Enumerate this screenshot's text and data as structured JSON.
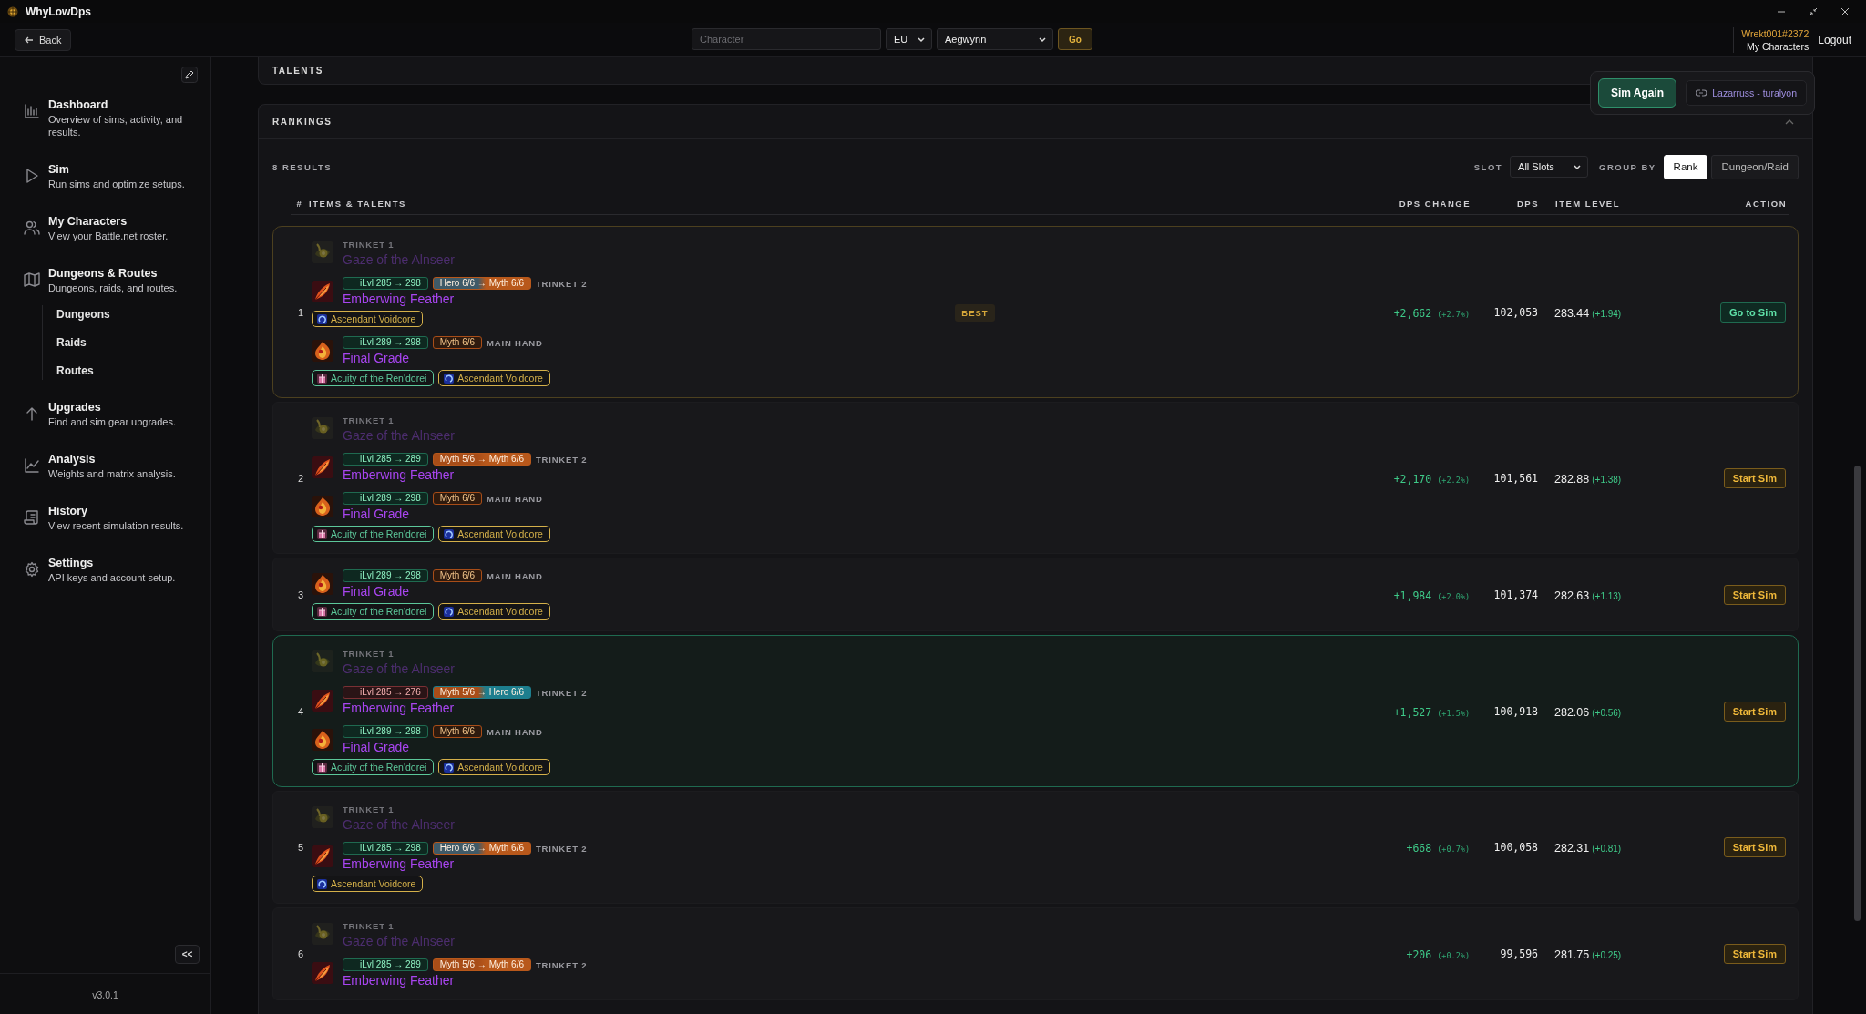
{
  "window": {
    "title": "WhyLowDps"
  },
  "topbar": {
    "back": "Back",
    "character": {
      "placeholder": "Character"
    },
    "region": "EU",
    "realm": "Aegwynn",
    "go": "Go",
    "battletag": "Wrekt001#2372",
    "my_characters": "My Characters",
    "logout": "Logout"
  },
  "sidebar": {
    "items": [
      {
        "title": "Dashboard",
        "desc": "Overview of sims, activity, and results."
      },
      {
        "title": "Sim",
        "desc": "Run sims and optimize setups."
      },
      {
        "title": "My Characters",
        "desc": "View your Battle.net roster."
      },
      {
        "title": "Dungeons & Routes",
        "desc": "Dungeons, raids, and routes.",
        "children": [
          {
            "label": "Dungeons"
          },
          {
            "label": "Raids"
          },
          {
            "label": "Routes"
          }
        ]
      },
      {
        "title": "Upgrades",
        "desc": "Find and sim gear upgrades."
      },
      {
        "title": "Analysis",
        "desc": "Weights and matrix analysis."
      },
      {
        "title": "History",
        "desc": "View recent simulation results."
      },
      {
        "title": "Settings",
        "desc": "API keys and account setup."
      }
    ],
    "collapse": "<<",
    "version": "v3.0.1"
  },
  "popup": {
    "primary": "Sim Again",
    "link": "Lazarruss - turalyon"
  },
  "talents": {
    "title": "TALENTS"
  },
  "rankings": {
    "title": "RANKINGS",
    "results": "8 RESULTS",
    "slot_label": "SLOT",
    "slot_value": "All Slots",
    "group_label": "GROUP BY",
    "group_options": [
      {
        "label": "Rank",
        "selected": true
      },
      {
        "label": "Dungeon/Raid",
        "selected": false
      }
    ],
    "columns": [
      "#",
      "ITEMS & TALENTS",
      "DPS CHANGE",
      "DPS",
      "ITEM LEVEL",
      "ACTION"
    ],
    "rows": [
      {
        "rank": "1",
        "best": true,
        "selected": false,
        "badge": "BEST",
        "items": [
          {
            "kind": "orb",
            "dimmed": true,
            "slot": "TRINKET 1",
            "name": "Gaze of the Alnseer"
          },
          {
            "kind": "feather",
            "dimmed": false,
            "ilvl": {
              "text": "iLvl 285 → 298",
              "downgrade": false
            },
            "track": {
              "text": "Hero 6/6 → Myth 6/6",
              "upgrade": true,
              "from_hero": true,
              "to_hero": false
            },
            "slot": "TRINKET 2",
            "name": "Emberwing Feather",
            "chips": [
              {
                "kind": "swirl",
                "text": "Ascendant Voidcore",
                "color": "#d4b04a"
              }
            ]
          },
          {
            "kind": "flame",
            "dimmed": false,
            "ilvl": {
              "text": "iLvl 289 → 298",
              "downgrade": false
            },
            "track": {
              "text": "Myth 6/6",
              "upgrade": false,
              "from_hero": false
            },
            "slot": "MAIN HAND",
            "name": "Final Grade",
            "chips": [
              {
                "kind": "ribbon",
                "text": "Acuity of the Ren'dorei",
                "color": "#5cc79a"
              },
              {
                "kind": "swirl",
                "text": "Ascendant Voidcore",
                "color": "#d4b04a"
              }
            ]
          }
        ],
        "dps_change": "+2,662",
        "dps_pct": "(+2.7%)",
        "dps": "102,053",
        "item_level": "283.44",
        "ilvl_delta": "(+1.94)",
        "action": "Go to Sim",
        "action_primary": true
      },
      {
        "rank": "2",
        "best": false,
        "selected": false,
        "items": [
          {
            "kind": "orb",
            "dimmed": true,
            "slot": "TRINKET 1",
            "name": "Gaze of the Alnseer"
          },
          {
            "kind": "feather",
            "dimmed": false,
            "ilvl": {
              "text": "iLvl 285 → 289",
              "downgrade": false
            },
            "track": {
              "text": "Myth 5/6 → Myth 6/6",
              "upgrade": true,
              "from_hero": false,
              "to_hero": false
            },
            "slot": "TRINKET 2",
            "name": "Emberwing Feather"
          },
          {
            "kind": "flame",
            "dimmed": false,
            "ilvl": {
              "text": "iLvl 289 → 298",
              "downgrade": false
            },
            "track": {
              "text": "Myth 6/6",
              "upgrade": false,
              "from_hero": false
            },
            "slot": "MAIN HAND",
            "name": "Final Grade",
            "chips": [
              {
                "kind": "ribbon",
                "text": "Acuity of the Ren'dorei",
                "color": "#5cc79a"
              },
              {
                "kind": "swirl",
                "text": "Ascendant Voidcore",
                "color": "#d4b04a"
              }
            ]
          }
        ],
        "dps_change": "+2,170",
        "dps_pct": "(+2.2%)",
        "dps": "101,561",
        "item_level": "282.88",
        "ilvl_delta": "(+1.38)",
        "action": "Start Sim",
        "action_primary": false
      },
      {
        "rank": "3",
        "best": false,
        "selected": false,
        "items": [
          {
            "kind": "flame",
            "dimmed": false,
            "ilvl": {
              "text": "iLvl 289 → 298",
              "downgrade": false
            },
            "track": {
              "text": "Myth 6/6",
              "upgrade": false,
              "from_hero": false
            },
            "slot": "MAIN HAND",
            "name": "Final Grade",
            "chips": [
              {
                "kind": "ribbon",
                "text": "Acuity of the Ren'dorei",
                "color": "#5cc79a"
              },
              {
                "kind": "swirl",
                "text": "Ascendant Voidcore",
                "color": "#d4b04a"
              }
            ]
          }
        ],
        "dps_change": "+1,984",
        "dps_pct": "(+2.0%)",
        "dps": "101,374",
        "item_level": "282.63",
        "ilvl_delta": "(+1.13)",
        "action": "Start Sim",
        "action_primary": false
      },
      {
        "rank": "4",
        "best": false,
        "selected": true,
        "items": [
          {
            "kind": "orb",
            "dimmed": true,
            "slot": "TRINKET 1",
            "name": "Gaze of the Alnseer"
          },
          {
            "kind": "feather",
            "dimmed": false,
            "ilvl": {
              "text": "iLvl 285 → 276",
              "downgrade": true
            },
            "track": {
              "text": "Myth 5/6 → Hero 6/6",
              "upgrade": true,
              "from_hero": false,
              "to_hero": true
            },
            "slot": "TRINKET 2",
            "name": "Emberwing Feather"
          },
          {
            "kind": "flame",
            "dimmed": false,
            "ilvl": {
              "text": "iLvl 289 → 298",
              "downgrade": false
            },
            "track": {
              "text": "Myth 6/6",
              "upgrade": false,
              "from_hero": false
            },
            "slot": "MAIN HAND",
            "name": "Final Grade",
            "chips": [
              {
                "kind": "ribbon",
                "text": "Acuity of the Ren'dorei",
                "color": "#5cc79a"
              },
              {
                "kind": "swirl",
                "text": "Ascendant Voidcore",
                "color": "#d4b04a"
              }
            ]
          }
        ],
        "dps_change": "+1,527",
        "dps_pct": "(+1.5%)",
        "dps": "100,918",
        "item_level": "282.06",
        "ilvl_delta": "(+0.56)",
        "action": "Start Sim",
        "action_primary": false
      },
      {
        "rank": "5",
        "best": false,
        "selected": false,
        "items": [
          {
            "kind": "orb",
            "dimmed": true,
            "slot": "TRINKET 1",
            "name": "Gaze of the Alnseer"
          },
          {
            "kind": "feather",
            "dimmed": false,
            "ilvl": {
              "text": "iLvl 285 → 298",
              "downgrade": false
            },
            "track": {
              "text": "Hero 6/6 → Myth 6/6",
              "upgrade": true,
              "from_hero": true,
              "to_hero": false
            },
            "slot": "TRINKET 2",
            "name": "Emberwing Feather",
            "chips": [
              {
                "kind": "swirl",
                "text": "Ascendant Voidcore",
                "color": "#d4b04a"
              }
            ]
          }
        ],
        "dps_change": "+668",
        "dps_pct": "(+0.7%)",
        "dps": "100,058",
        "item_level": "282.31",
        "ilvl_delta": "(+0.81)",
        "action": "Start Sim",
        "action_primary": false
      },
      {
        "rank": "6",
        "best": false,
        "selected": false,
        "items": [
          {
            "kind": "orb",
            "dimmed": true,
            "slot": "TRINKET 1",
            "name": "Gaze of the Alnseer"
          },
          {
            "kind": "feather",
            "dimmed": false,
            "ilvl": {
              "text": "iLvl 285 → 289",
              "downgrade": false
            },
            "track": {
              "text": "Myth 5/6 → Myth 6/6",
              "upgrade": true,
              "from_hero": false,
              "to_hero": false
            },
            "slot": "TRINKET 2",
            "name": "Emberwing Feather"
          }
        ],
        "dps_change": "+206",
        "dps_pct": "(+0.2%)",
        "dps": "99,596",
        "item_level": "281.75",
        "ilvl_delta": "(+0.25)",
        "action": "Start Sim",
        "action_primary": false
      }
    ]
  }
}
